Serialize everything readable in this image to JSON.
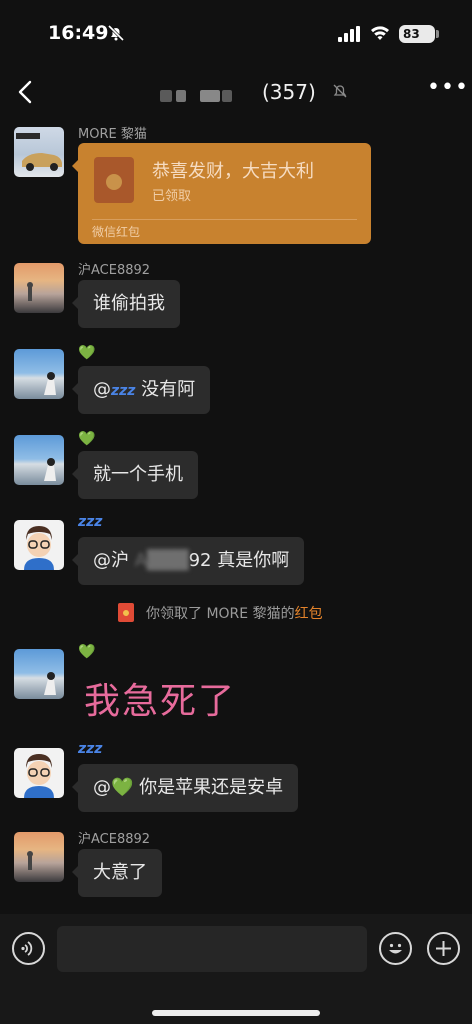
{
  "status_bar": {
    "time": "16:49",
    "battery": "83"
  },
  "header": {
    "member_count": "(357)"
  },
  "messages": [
    {
      "sender": "MORE 黎猫",
      "redpacket": {
        "title": "恭喜发财，大吉大利",
        "status": "已领取",
        "footer": "微信红包"
      }
    },
    {
      "sender": "沪ACE8892",
      "text": "谁偷拍我"
    },
    {
      "sender_icon": "💚",
      "text_prefix": "@",
      "text_zzz": "zzz",
      "text": " 没有阿"
    },
    {
      "sender_icon": "💚",
      "text": "就一个手机"
    },
    {
      "sender_icon": "zzz",
      "text_prefix": "@沪 ",
      "text_redacted": "A███",
      "text": "92 真是你啊"
    },
    {
      "system_text": "你领取了 MORE 黎猫的",
      "system_link": "红包"
    },
    {
      "sender_icon": "💚",
      "text": "我急死了"
    },
    {
      "sender_icon": "zzz",
      "text_prefix": "@",
      "text_heart": "💚",
      "text": " 你是苹果还是安卓"
    },
    {
      "sender": "沪ACE8892",
      "text": "大意了"
    }
  ],
  "colors": {
    "background": "#111111",
    "bubble": "#2c2c2c",
    "redpacket": "#c8822f",
    "big_text": "#e76b9c",
    "link": "#e3832b"
  },
  "icons": [
    "bell-slash-icon",
    "signal-icon",
    "wifi-icon",
    "battery-icon",
    "back-icon",
    "mute-icon",
    "more-icon",
    "voice-icon",
    "emoji-icon",
    "plus-icon"
  ]
}
